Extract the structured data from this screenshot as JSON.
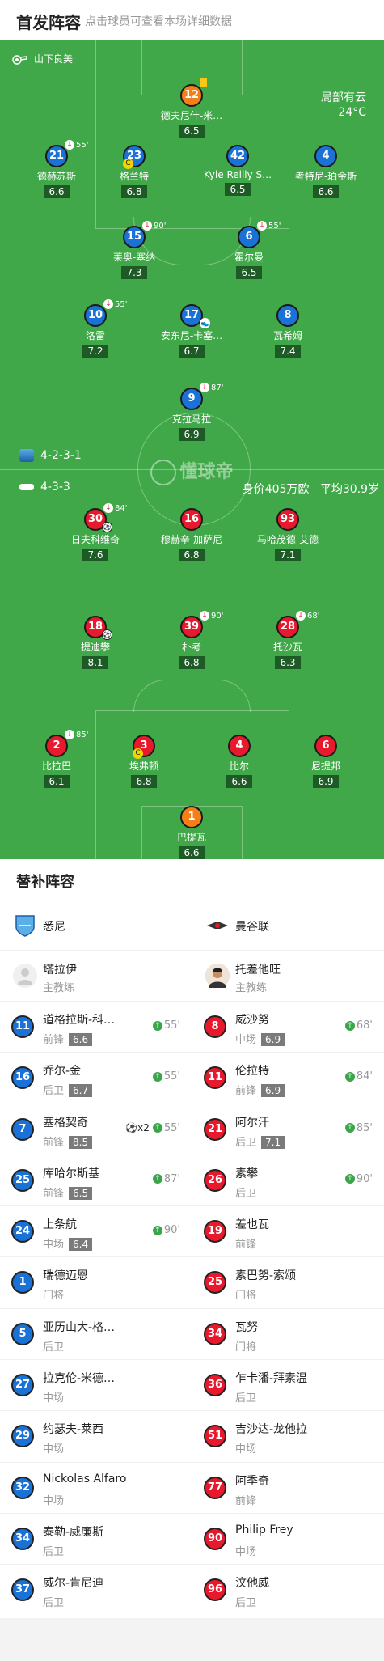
{
  "header": {
    "title": "首发阵容",
    "subtitle": "点击球员可查看本场详细数据"
  },
  "referee": "山下良美",
  "weather": {
    "condition": "局部有云",
    "temp": "24°C"
  },
  "watermark": "懂球帝",
  "home_formation": "4-2-3-1",
  "away_formation": "4-3-3",
  "away_value": "身价405万欧",
  "away_age": "平均30.9岁",
  "home_players": [
    {
      "num": "12",
      "name": "德夫尼什-米…",
      "rating": "6.5",
      "color": "orange",
      "card": true
    },
    {
      "num": "21",
      "name": "德赫苏斯",
      "rating": "6.6",
      "color": "blue",
      "sub": "55'"
    },
    {
      "num": "23",
      "name": "格兰特",
      "rating": "6.8",
      "color": "blue",
      "captain": true
    },
    {
      "num": "42",
      "name": "Kyle Reilly S…",
      "rating": "6.5",
      "color": "blue"
    },
    {
      "num": "4",
      "name": "考特尼-珀金斯",
      "rating": "6.6",
      "color": "blue"
    },
    {
      "num": "15",
      "name": "莱奥-塞纳",
      "rating": "7.3",
      "color": "blue",
      "sub": "90'"
    },
    {
      "num": "6",
      "name": "霍尔曼",
      "rating": "6.5",
      "color": "blue",
      "sub": "55'"
    },
    {
      "num": "10",
      "name": "洛雷",
      "rating": "7.2",
      "color": "blue",
      "sub": "55'"
    },
    {
      "num": "17",
      "name": "安东尼-卡塞…",
      "rating": "6.7",
      "color": "blue",
      "assist": true
    },
    {
      "num": "8",
      "name": "瓦希姆",
      "rating": "7.4",
      "color": "blue"
    },
    {
      "num": "9",
      "name": "克拉马拉",
      "rating": "6.9",
      "color": "blue",
      "sub": "87'"
    }
  ],
  "away_players": [
    {
      "num": "30",
      "name": "日夫科维奇",
      "rating": "7.6",
      "color": "red",
      "sub": "84'",
      "goal": true
    },
    {
      "num": "16",
      "name": "穆赫辛-加萨尼",
      "rating": "6.8",
      "color": "red"
    },
    {
      "num": "93",
      "name": "马哈茂德-艾德",
      "rating": "7.1",
      "color": "red"
    },
    {
      "num": "18",
      "name": "提迪攀",
      "rating": "8.1",
      "color": "red",
      "goal": true
    },
    {
      "num": "39",
      "name": "朴考",
      "rating": "6.8",
      "color": "red",
      "sub": "90'"
    },
    {
      "num": "28",
      "name": "托沙瓦",
      "rating": "6.3",
      "color": "red",
      "sub": "68'"
    },
    {
      "num": "2",
      "name": "比拉巴",
      "rating": "6.1",
      "color": "red",
      "sub": "85'"
    },
    {
      "num": "3",
      "name": "埃弗顿",
      "rating": "6.8",
      "color": "red",
      "captain": true
    },
    {
      "num": "4",
      "name": "比尔",
      "rating": "6.6",
      "color": "red"
    },
    {
      "num": "6",
      "name": "尼提邦",
      "rating": "6.9",
      "color": "red"
    },
    {
      "num": "1",
      "name": "巴提瓦",
      "rating": "6.6",
      "color": "orange"
    }
  ],
  "subs": {
    "title": "替补阵容",
    "home": {
      "team": "悉尼",
      "coach": "塔拉伊",
      "coach_role": "主教练",
      "players": [
        {
          "num": "11",
          "name": "道格拉斯-科…",
          "pos": "前锋",
          "rating": "6.6",
          "time": "55'"
        },
        {
          "num": "16",
          "name": "乔尔-金",
          "pos": "后卫",
          "rating": "6.7",
          "time": "55'"
        },
        {
          "num": "7",
          "name": "塞格契奇",
          "pos": "前锋",
          "rating": "8.5",
          "time": "55'",
          "goals": "x2"
        },
        {
          "num": "25",
          "name": "库哈尔斯基",
          "pos": "前锋",
          "rating": "6.5",
          "time": "87'"
        },
        {
          "num": "24",
          "name": "上条航",
          "pos": "中场",
          "rating": "6.4",
          "time": "90'"
        },
        {
          "num": "1",
          "name": "瑞德迈恩",
          "pos": "门将"
        },
        {
          "num": "5",
          "name": "亚历山大-格…",
          "pos": "后卫"
        },
        {
          "num": "27",
          "name": "拉克伦-米德…",
          "pos": "中场"
        },
        {
          "num": "29",
          "name": "约瑟夫-莱西",
          "pos": "中场"
        },
        {
          "num": "32",
          "name": "Nickolas Alfaro",
          "pos": "中场"
        },
        {
          "num": "34",
          "name": "泰勒-威廉斯",
          "pos": "后卫"
        },
        {
          "num": "37",
          "name": "威尔-肯尼迪",
          "pos": "后卫"
        }
      ]
    },
    "away": {
      "team": "曼谷联",
      "coach": "托差他旺",
      "coach_role": "主教练",
      "players": [
        {
          "num": "8",
          "name": "威沙努",
          "pos": "中场",
          "rating": "6.9",
          "time": "68'"
        },
        {
          "num": "11",
          "name": "伦拉特",
          "pos": "前锋",
          "rating": "6.9",
          "time": "84'"
        },
        {
          "num": "21",
          "name": "阿尔汗",
          "pos": "后卫",
          "rating": "7.1",
          "time": "85'"
        },
        {
          "num": "26",
          "name": "素攀",
          "pos": "后卫",
          "time": "90'"
        },
        {
          "num": "19",
          "name": "差也瓦",
          "pos": "前锋"
        },
        {
          "num": "25",
          "name": "素巴努-索颂",
          "pos": "门将"
        },
        {
          "num": "34",
          "name": "瓦努",
          "pos": "门将"
        },
        {
          "num": "36",
          "name": "乍卡潘-拜素温",
          "pos": "后卫"
        },
        {
          "num": "51",
          "name": "吉沙达-龙他拉",
          "pos": "中场"
        },
        {
          "num": "77",
          "name": "阿季奇",
          "pos": "前锋"
        },
        {
          "num": "90",
          "name": "Philip Frey",
          "pos": "中场"
        },
        {
          "num": "96",
          "name": "汶他威",
          "pos": "后卫"
        }
      ]
    }
  }
}
